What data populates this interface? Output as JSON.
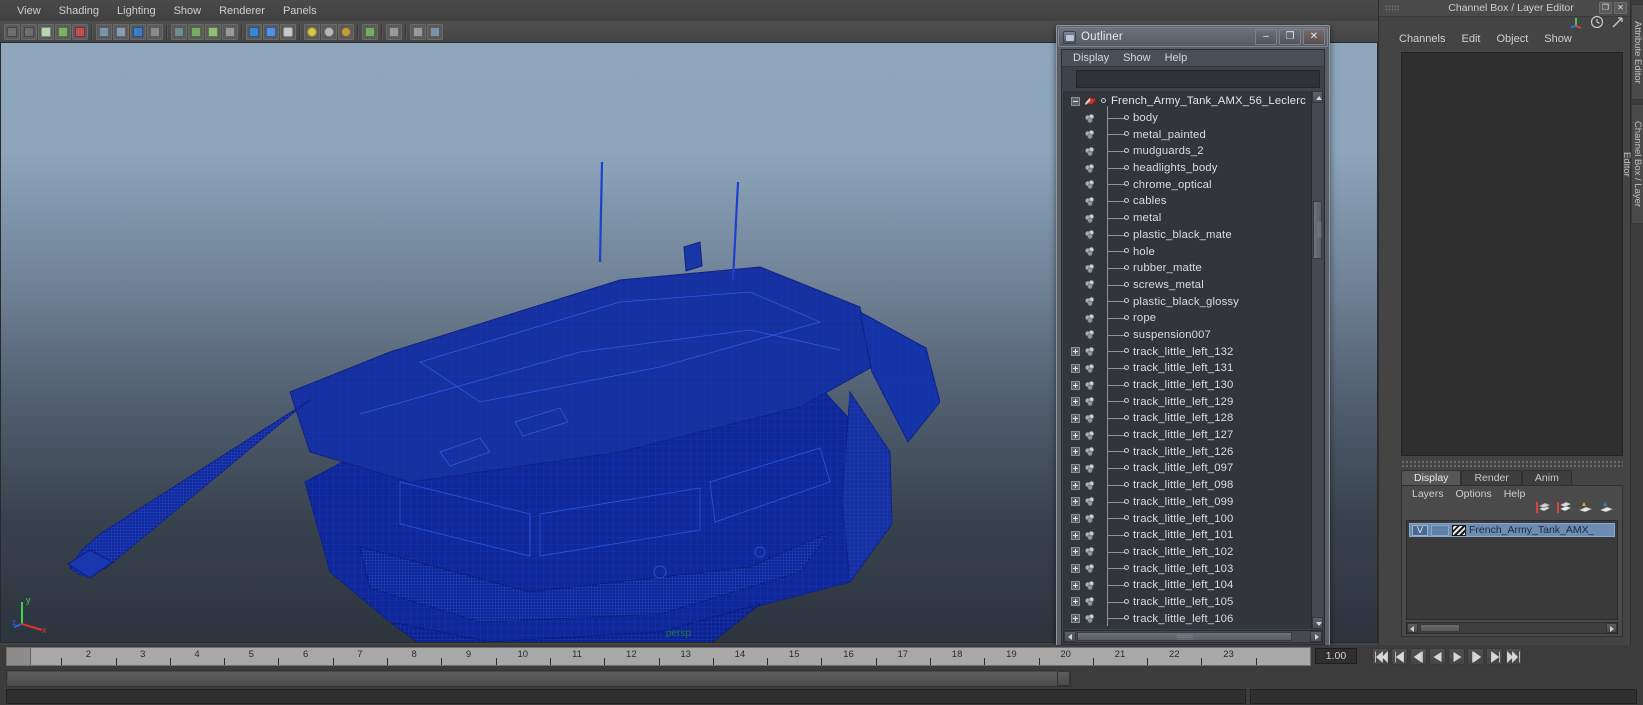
{
  "app": {
    "viewport_label": "persp",
    "axis_labels": {
      "y": "y",
      "x": "x",
      "z": "z"
    }
  },
  "panel_menu": {
    "items": [
      {
        "label": "View",
        "name": "menu-view"
      },
      {
        "label": "Shading",
        "name": "menu-shading"
      },
      {
        "label": "Lighting",
        "name": "menu-lighting"
      },
      {
        "label": "Show",
        "name": "menu-show"
      },
      {
        "label": "Renderer",
        "name": "menu-renderer"
      },
      {
        "label": "Panels",
        "name": "menu-panels"
      }
    ]
  },
  "panel_toolbar": {
    "icons": [
      {
        "name": "select-camera-icon",
        "color": "#6e6e6e"
      },
      {
        "name": "camera-attributes-icon",
        "color": "#6e6e6e"
      },
      {
        "name": "bookmarks-icon",
        "color": "#b9d6b0"
      },
      {
        "name": "image-plane-icon",
        "color": "#7fae63"
      },
      {
        "name": "two-d-pan-zoom-icon",
        "color": "#b85050"
      },
      {
        "name": "grid-toggle-icon",
        "color": "#7d94a8"
      },
      {
        "name": "film-gate-icon",
        "color": "#8a9bb0"
      },
      {
        "name": "resolution-gate-icon",
        "color": "#3a7ec8"
      },
      {
        "name": "gate-mask-icon",
        "color": "#8a8a8a"
      },
      {
        "name": "xray-toggle-icon",
        "color": "#6e8e8e"
      },
      {
        "name": "xray-joints-icon",
        "color": "#79a861"
      },
      {
        "name": "texture-toggle-icon",
        "color": "#8fbf72"
      },
      {
        "name": "wireframe-shading-icon",
        "color": "#9a9a9a"
      },
      {
        "name": "smooth-shade-all-icon",
        "color": "#3a86d6"
      },
      {
        "name": "smooth-shade-textured-icon",
        "color": "#4f93de"
      },
      {
        "name": "use-default-material-icon",
        "color": "#c8c8c8"
      },
      {
        "name": "lighting-default-icon",
        "color": "#d8c84a"
      },
      {
        "name": "lighting-all-icon",
        "color": "#b8b8b8"
      },
      {
        "name": "lighting-shadows-icon",
        "color": "#c09a3e"
      },
      {
        "name": "isolate-select-icon",
        "color": "#79a861"
      },
      {
        "name": "xray-display-icon",
        "color": "#9a9a9a"
      },
      {
        "name": "exposure-icon",
        "color": "#9a9a9a"
      },
      {
        "name": "gamma-icon",
        "color": "#7d94a8"
      }
    ]
  },
  "outliner": {
    "title": "Outliner",
    "window_buttons": [
      {
        "name": "minimize-button",
        "glyph": "–"
      },
      {
        "name": "maximize-button",
        "glyph": "❐"
      },
      {
        "name": "close-button",
        "glyph": "✕"
      }
    ],
    "menus": [
      {
        "label": "Display",
        "name": "outliner-menu-display"
      },
      {
        "label": "Show",
        "name": "outliner-menu-show"
      },
      {
        "label": "Help",
        "name": "outliner-menu-help"
      }
    ],
    "search_value": "",
    "rows": [
      {
        "label": "French_Army_Tank_AMX_56_Leclerc",
        "expander": "minus",
        "icon": "transform-group-icon",
        "depth": 0
      },
      {
        "label": "body",
        "expander": "none",
        "icon": "mesh-icon",
        "depth": 1
      },
      {
        "label": "metal_painted",
        "expander": "none",
        "icon": "mesh-icon",
        "depth": 1
      },
      {
        "label": "mudguards_2",
        "expander": "none",
        "icon": "mesh-icon",
        "depth": 1
      },
      {
        "label": "headlights_body",
        "expander": "none",
        "icon": "mesh-icon",
        "depth": 1
      },
      {
        "label": "chrome_optical",
        "expander": "none",
        "icon": "mesh-icon",
        "depth": 1
      },
      {
        "label": "cables",
        "expander": "none",
        "icon": "mesh-icon",
        "depth": 1
      },
      {
        "label": "metal",
        "expander": "none",
        "icon": "mesh-icon",
        "depth": 1
      },
      {
        "label": "plastic_black_mate",
        "expander": "none",
        "icon": "mesh-icon",
        "depth": 1
      },
      {
        "label": "hole",
        "expander": "none",
        "icon": "mesh-icon",
        "depth": 1
      },
      {
        "label": "rubber_matte",
        "expander": "none",
        "icon": "mesh-icon",
        "depth": 1
      },
      {
        "label": "screws_metal",
        "expander": "none",
        "icon": "mesh-icon",
        "depth": 1
      },
      {
        "label": "plastic_black_glossy",
        "expander": "none",
        "icon": "mesh-icon",
        "depth": 1
      },
      {
        "label": "rope",
        "expander": "none",
        "icon": "mesh-icon",
        "depth": 1
      },
      {
        "label": "suspension007",
        "expander": "none",
        "icon": "mesh-icon",
        "depth": 1
      },
      {
        "label": "track_little_left_132",
        "expander": "plus",
        "icon": "mesh-icon",
        "depth": 1
      },
      {
        "label": "track_little_left_131",
        "expander": "plus",
        "icon": "mesh-icon",
        "depth": 1
      },
      {
        "label": "track_little_left_130",
        "expander": "plus",
        "icon": "mesh-icon",
        "depth": 1
      },
      {
        "label": "track_little_left_129",
        "expander": "plus",
        "icon": "mesh-icon",
        "depth": 1
      },
      {
        "label": "track_little_left_128",
        "expander": "plus",
        "icon": "mesh-icon",
        "depth": 1
      },
      {
        "label": "track_little_left_127",
        "expander": "plus",
        "icon": "mesh-icon",
        "depth": 1
      },
      {
        "label": "track_little_left_126",
        "expander": "plus",
        "icon": "mesh-icon",
        "depth": 1
      },
      {
        "label": "track_little_left_097",
        "expander": "plus",
        "icon": "mesh-icon",
        "depth": 1
      },
      {
        "label": "track_little_left_098",
        "expander": "plus",
        "icon": "mesh-icon",
        "depth": 1
      },
      {
        "label": "track_little_left_099",
        "expander": "plus",
        "icon": "mesh-icon",
        "depth": 1
      },
      {
        "label": "track_little_left_100",
        "expander": "plus",
        "icon": "mesh-icon",
        "depth": 1
      },
      {
        "label": "track_little_left_101",
        "expander": "plus",
        "icon": "mesh-icon",
        "depth": 1
      },
      {
        "label": "track_little_left_102",
        "expander": "plus",
        "icon": "mesh-icon",
        "depth": 1
      },
      {
        "label": "track_little_left_103",
        "expander": "plus",
        "icon": "mesh-icon",
        "depth": 1
      },
      {
        "label": "track_little_left_104",
        "expander": "plus",
        "icon": "mesh-icon",
        "depth": 1
      },
      {
        "label": "track_little_left_105",
        "expander": "plus",
        "icon": "mesh-icon",
        "depth": 1
      },
      {
        "label": "track_little_left_106",
        "expander": "plus",
        "icon": "mesh-icon",
        "depth": 1
      }
    ]
  },
  "right_panel": {
    "title": "Channel Box / Layer Editor",
    "window_buttons": [
      {
        "name": "restore-button",
        "glyph": "❐"
      },
      {
        "name": "close-button",
        "glyph": "✕"
      }
    ],
    "header_icons": [
      {
        "name": "channel-box-axis-icon"
      },
      {
        "name": "channel-box-clock-icon"
      },
      {
        "name": "channel-box-arrow-icon"
      }
    ],
    "menus": [
      {
        "label": "Channels",
        "name": "channelbox-menu-channels"
      },
      {
        "label": "Edit",
        "name": "channelbox-menu-edit"
      },
      {
        "label": "Object",
        "name": "channelbox-menu-object"
      },
      {
        "label": "Show",
        "name": "channelbox-menu-show"
      }
    ],
    "layer_tabs": [
      {
        "label": "Display",
        "name": "tab-display",
        "active": true
      },
      {
        "label": "Render",
        "name": "tab-render",
        "active": false
      },
      {
        "label": "Anim",
        "name": "tab-anim",
        "active": false
      }
    ],
    "layer_menus": [
      {
        "label": "Layers",
        "name": "layers-menu-layers"
      },
      {
        "label": "Options",
        "name": "layers-menu-options"
      },
      {
        "label": "Help",
        "name": "layers-menu-help"
      }
    ],
    "layer_icons": [
      {
        "name": "new-layer-icon"
      },
      {
        "name": "new-layer-from-selected-icon"
      },
      {
        "name": "layer-sort-icon"
      },
      {
        "name": "layer-membership-icon"
      }
    ],
    "layers": [
      {
        "visibility": "V",
        "playback": "",
        "name": "French_Army_Tank_AMX_",
        "color": "#1d2b3c"
      }
    ],
    "side_tabs": [
      {
        "label": "Attribute Editor",
        "name": "vtab-attribute-editor"
      },
      {
        "label": "Channel Box / Layer Editor",
        "name": "vtab-channel-box"
      }
    ]
  },
  "timeline": {
    "start": 1,
    "end": 24,
    "ticks": [
      2,
      3,
      4,
      5,
      6,
      7,
      8,
      9,
      10,
      11,
      12,
      13,
      14,
      15,
      16,
      17,
      18,
      19,
      20,
      21,
      22,
      23
    ],
    "current_frame_field": "1.00",
    "playback_buttons": [
      {
        "name": "go-to-start-button",
        "glyph": "|◀◀"
      },
      {
        "name": "step-back-key-button",
        "glyph": "|◀"
      },
      {
        "name": "step-back-frame-button",
        "glyph": "◀|"
      },
      {
        "name": "play-backwards-button",
        "glyph": "◀"
      },
      {
        "name": "play-forwards-button",
        "glyph": "▶"
      },
      {
        "name": "step-forward-frame-button",
        "glyph": "|▶"
      },
      {
        "name": "step-forward-key-button",
        "glyph": "▶|"
      },
      {
        "name": "go-to-end-button",
        "glyph": "▶▶|"
      }
    ]
  }
}
